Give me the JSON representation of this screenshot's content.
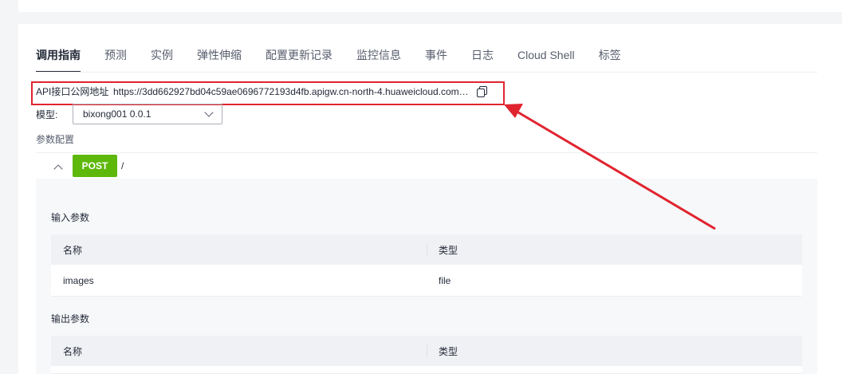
{
  "tabs": [
    {
      "label": "调用指南",
      "active": true
    },
    {
      "label": "预测"
    },
    {
      "label": "实例"
    },
    {
      "label": "弹性伸缩"
    },
    {
      "label": "配置更新记录"
    },
    {
      "label": "监控信息"
    },
    {
      "label": "事件"
    },
    {
      "label": "日志"
    },
    {
      "label": "Cloud Shell"
    },
    {
      "label": "标签"
    }
  ],
  "api": {
    "label": "API接口公网地址",
    "url": "https://3dd662927bd04c59ae0696772193d4fb.apigw.cn-north-4.huaweicloud.com/v1/infers/..."
  },
  "model": {
    "label": "模型:",
    "value": "bixong001 0.0.1"
  },
  "params": {
    "title": "参数配置",
    "method": "POST",
    "path": "/",
    "input_title": "输入参数",
    "output_title": "输出参数",
    "columns": [
      "名称",
      "类型"
    ],
    "input_rows": [
      {
        "name": "images",
        "type": "file"
      }
    ]
  },
  "annotation": {
    "highlight_color": "#e0242f"
  }
}
